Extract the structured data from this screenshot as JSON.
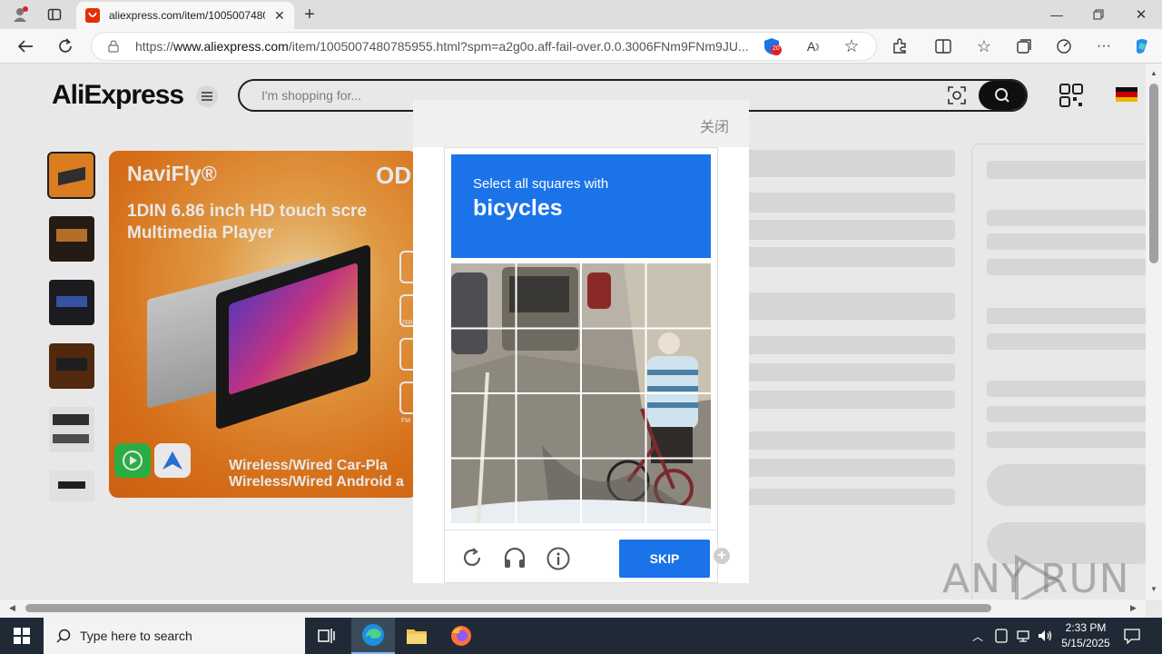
{
  "browser": {
    "tab_title": "aliexpress.com/item/1005007480",
    "url_prefix": "https://",
    "url_domain": "www.aliexpress.com",
    "url_path": "/item/1005007480785955.html?spm=a2g0o.aff-fail-over.0.0.3006FNm9FNm9JU...",
    "badge_count": "20"
  },
  "site": {
    "logo": "AliExpress",
    "search_placeholder": "I'm shopping for..."
  },
  "product": {
    "brand": "NaviFly®",
    "brand_right": "OD",
    "headline_1": "1DIN 6.86 inch HD touch scre",
    "headline_2": "Multimedia Player",
    "footer_1": "Wireless/Wired Car-Pla",
    "footer_2": "Wireless/Wired Android a",
    "side_labels": [
      "USB",
      "FM"
    ]
  },
  "captcha": {
    "close_label": "关闭",
    "instruction": "Select all squares with",
    "target": "bicycles",
    "skip_label": "SKIP",
    "grid_rows": 4,
    "grid_cols": 4
  },
  "watermark": "ANY RUN",
  "taskbar": {
    "search_placeholder": "Type here to search",
    "time": "2:33 PM",
    "date": "5/15/2025"
  },
  "colors": {
    "accent": "#1a73e8",
    "brand": "#e62e04",
    "product_orange": "#f08a24"
  }
}
